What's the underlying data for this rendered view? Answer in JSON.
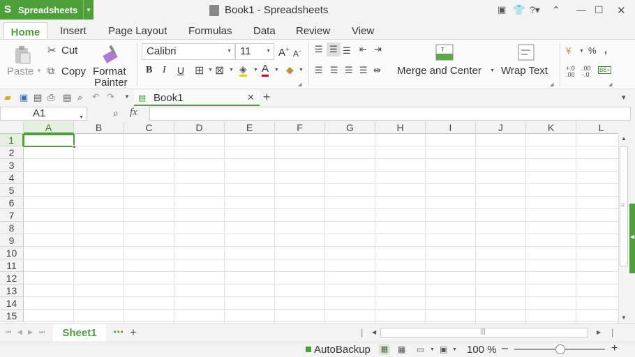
{
  "app": {
    "name": "Spreadsheets",
    "window_title": "Book1 - Spreadsheets"
  },
  "menu_tabs": [
    "Home",
    "Insert",
    "Page Layout",
    "Formulas",
    "Data",
    "Review",
    "View"
  ],
  "ribbon": {
    "paste": "Paste",
    "cut": "Cut",
    "copy": "Copy",
    "format_painter_1": "Format",
    "format_painter_2": "Painter",
    "font_name": "Calibri",
    "font_size": "11",
    "bold": "B",
    "italic": "I",
    "underline": "U",
    "merge_center": "Merge and Center",
    "wrap_text": "Wrap Text",
    "percent": "%",
    "comma": ","
  },
  "doc_tab": {
    "label": "Book1"
  },
  "formula_bar": {
    "cell_ref": "A1",
    "fx": "fx",
    "value": ""
  },
  "grid": {
    "columns": [
      "A",
      "B",
      "C",
      "D",
      "E",
      "F",
      "G",
      "H",
      "I",
      "J",
      "K",
      "L"
    ],
    "rows": [
      "1",
      "2",
      "3",
      "4",
      "5",
      "6",
      "7",
      "8",
      "9",
      "10",
      "11",
      "12",
      "13",
      "14",
      "15"
    ],
    "active_cell": "A1"
  },
  "sheets": {
    "active": "Sheet1",
    "more": "⋯",
    "add": "+"
  },
  "status": {
    "autobackup": "AutoBackup",
    "zoom": "100 %",
    "zoom_minus": "–",
    "zoom_plus": "+"
  },
  "colors": {
    "accent": "#4d9f3a"
  }
}
